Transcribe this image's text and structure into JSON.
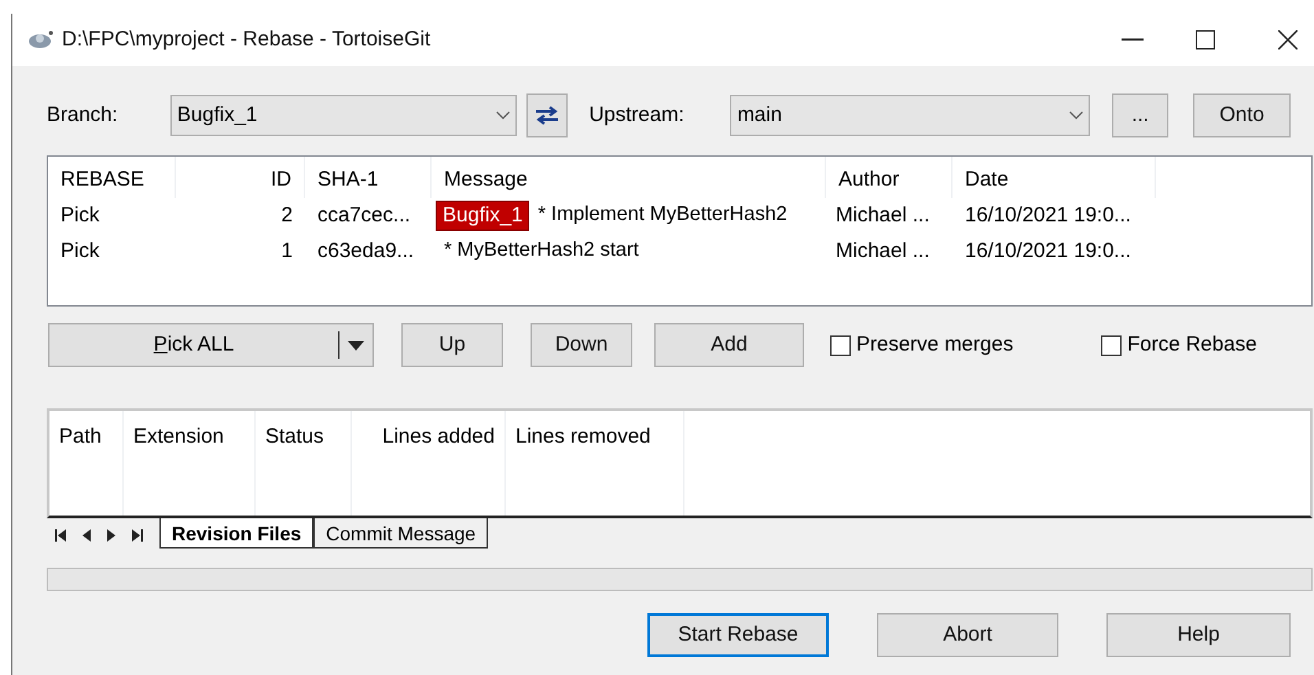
{
  "window": {
    "title": "D:\\FPC\\myproject - Rebase - TortoiseGit"
  },
  "branch": {
    "label": "Branch:",
    "value": "Bugfix_1"
  },
  "upstream": {
    "label": "Upstream:",
    "value": "main",
    "more_button": "...",
    "onto_button": "Onto"
  },
  "commits": {
    "columns": [
      "REBASE",
      "ID",
      "SHA-1",
      "Message",
      "Author",
      "Date"
    ],
    "rows": [
      {
        "action": "Pick",
        "id": "2",
        "sha": "cca7cec...",
        "badge": "Bugfix_1",
        "message": "* Implement MyBetterHash2",
        "author": "Michael ...",
        "date": "16/10/2021 19:0..."
      },
      {
        "action": "Pick",
        "id": "1",
        "sha": "c63eda9...",
        "message": "* MyBetterHash2 start",
        "author": "Michael ...",
        "date": "16/10/2021 19:0..."
      }
    ]
  },
  "actions": {
    "pick_all": "Pick ALL",
    "buttons": [
      "Up",
      "Down",
      "Add"
    ]
  },
  "options": [
    {
      "label": "Preserve merges",
      "checked": false
    },
    {
      "label": "Force Rebase",
      "checked": false
    }
  ],
  "files": {
    "columns": [
      "Path",
      "Extension",
      "Status",
      "Lines added",
      "Lines removed"
    ]
  },
  "tabs": [
    {
      "label": "Revision Files",
      "selected": true
    },
    {
      "label": "Commit Message",
      "selected": false
    }
  ],
  "progress": {
    "level": 0
  },
  "footer_buttons": [
    {
      "label": "Start Rebase",
      "default": true
    },
    {
      "label": "Abort",
      "default": false
    },
    {
      "label": "Help",
      "default": false
    }
  ]
}
